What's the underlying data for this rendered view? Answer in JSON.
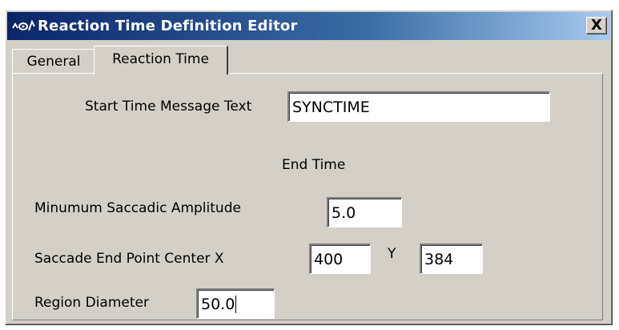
{
  "window": {
    "title": "Reaction Time Definition Editor",
    "icon": "eye-wave-icon",
    "close_label": "X"
  },
  "tabs": [
    {
      "label": "General",
      "active": false
    },
    {
      "label": "Reaction Time",
      "active": true
    }
  ],
  "form": {
    "start_time_label": "Start Time Message Text",
    "start_time_value": "SYNCTIME",
    "end_time_label": "End Time",
    "min_amplitude_label": "Minumum Saccadic Amplitude",
    "min_amplitude_value": "5.0",
    "center_x_label": "Saccade End Point Center X",
    "center_x_value": "400",
    "center_y_label": "Y",
    "center_y_value": "384",
    "region_diameter_label": "Region Diameter",
    "region_diameter_value": "50.0"
  },
  "colors": {
    "titlebar_start": "#0a246a",
    "titlebar_end": "#a6caf0",
    "face": "#d4d0c8"
  }
}
